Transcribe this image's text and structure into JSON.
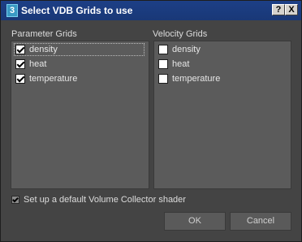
{
  "window": {
    "title": "Select VDB Grids to use",
    "help_label": "?",
    "close_label": "X"
  },
  "parameter_grids": {
    "label": "Parameter Grids",
    "items": [
      {
        "label": "density",
        "checked": true
      },
      {
        "label": "heat",
        "checked": true
      },
      {
        "label": "temperature",
        "checked": true
      }
    ]
  },
  "velocity_grids": {
    "label": "Velocity Grids",
    "items": [
      {
        "label": "density",
        "checked": false
      },
      {
        "label": "heat",
        "checked": false
      },
      {
        "label": "temperature",
        "checked": false
      }
    ]
  },
  "options": {
    "volume_collector_label": "Set up a default Volume Collector shader",
    "volume_collector_checked": true
  },
  "buttons": {
    "ok_label": "OK",
    "cancel_label": "Cancel"
  },
  "colors": {
    "titlebar": "#1d3f86",
    "dialog_bg": "#444444",
    "list_bg": "#5b5b5b"
  }
}
